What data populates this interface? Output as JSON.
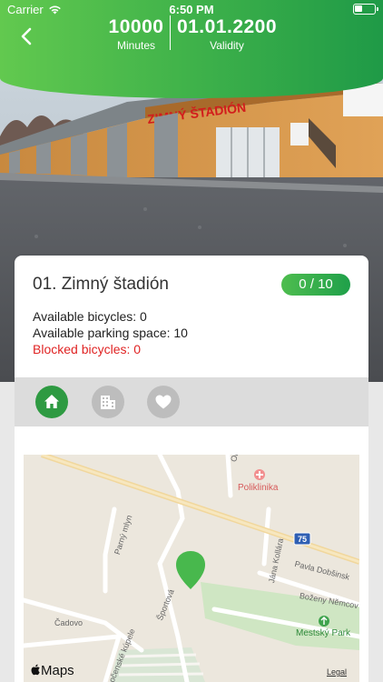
{
  "status_bar": {
    "carrier": "Carrier",
    "time": "6:50 PM"
  },
  "header": {
    "minutes_value": "10000",
    "minutes_label": "Minutes",
    "validity_value": "01.01.2200",
    "validity_label": "Validity"
  },
  "hero": {
    "sign_text": "ZIMNÝ ŠTADIÓN"
  },
  "station": {
    "title": "01. Zimný štadión",
    "occupancy": "0 / 10",
    "available_bicycles": "Available bicycles: 0",
    "available_parking": "Available parking space: 10",
    "blocked_bicycles": "Blocked bicycles: 0"
  },
  "tabs": [
    {
      "icon": "home-icon",
      "active": true
    },
    {
      "icon": "building-icon",
      "active": false
    },
    {
      "icon": "heart-icon",
      "active": false
    }
  ],
  "map": {
    "labels": {
      "okruzna": "Okružná",
      "poliklinika": "Poliklinika",
      "parny_mlyn": "Parný mlyn",
      "road_number": "75",
      "jana_kollara": "Jána Kollára",
      "sportova": "Športová",
      "pavla_dobsinskeho": "Pavla Dobšinsk",
      "bozeny_nemcovej": "Boženy Němcov",
      "cadovo": "Čadovo",
      "mestsky_park": "Mestský Park",
      "kupele": "očenské kúpele"
    },
    "provider": "Maps",
    "legal": "Legal"
  },
  "colors": {
    "accent_green": "#2e9a42",
    "header_gradient_start": "#62c94f",
    "header_gradient_end": "#1f9a47",
    "blocked_red": "#e02424"
  }
}
